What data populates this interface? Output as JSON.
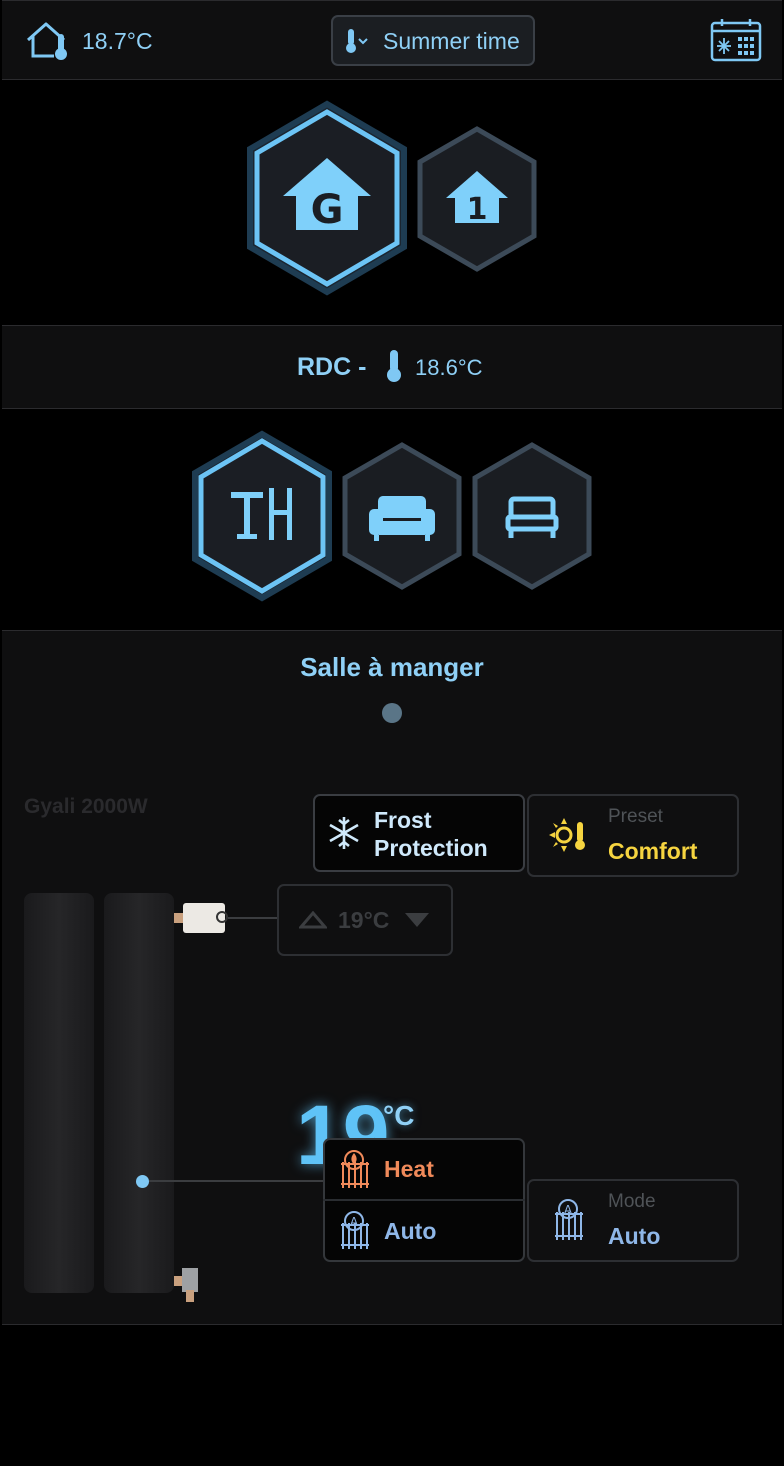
{
  "header": {
    "temperature": "18.7°C",
    "season_label": "Summer time",
    "icons": [
      "home-thermometer-icon",
      "thermometer-chevron-icon",
      "calendar-snowflake-icon"
    ]
  },
  "floors": [
    {
      "label": "G",
      "active": true
    },
    {
      "label": "1",
      "active": false
    }
  ],
  "floor_bar": {
    "name": "RDC -",
    "temperature": "18.6°C"
  },
  "rooms": [
    {
      "icon": "dining-table-icon",
      "active": true
    },
    {
      "icon": "sofa-icon",
      "active": false
    },
    {
      "icon": "bed-icon",
      "active": false
    }
  ],
  "room": {
    "title": "Salle à manger",
    "device_name": "Gyali 2000W",
    "frost": {
      "label_line1": "Frost",
      "label_line2": "Protection"
    },
    "preset": {
      "caption": "Preset",
      "value": "Comfort"
    },
    "setpoint": "19°C",
    "current_temp": {
      "value": "19",
      "unit": "°C"
    },
    "mode_list": [
      {
        "label": "Heat",
        "color": "#f08a5a"
      },
      {
        "label": "Auto",
        "color": "#8fb7e8"
      }
    ],
    "mode": {
      "caption": "Mode",
      "value": "Auto"
    }
  },
  "colors": {
    "accent": "#7fc8f4",
    "preset": "#f6d440",
    "heat": "#f08a5a",
    "hex_inactive_stroke": "#3c4a58"
  }
}
